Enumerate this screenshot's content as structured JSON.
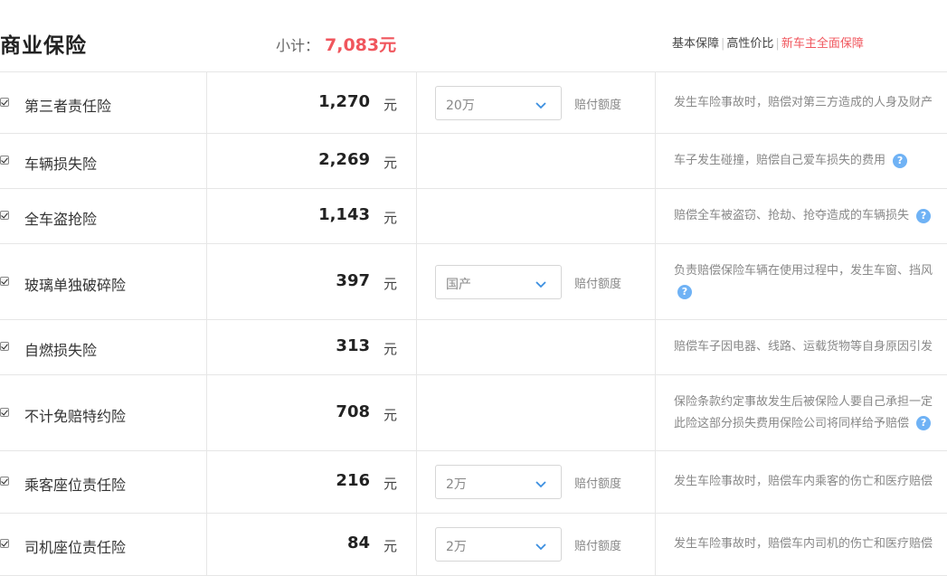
{
  "header": {
    "title": "商业保险",
    "subtotal_label": "小计：",
    "subtotal_value": "7,083元",
    "plans": [
      "基本保障",
      "高性价比",
      "新车主全面保障"
    ]
  },
  "currency_unit": "元",
  "coverage_label": "赔付额度",
  "colors": {
    "accent": "#f0565d",
    "help_icon": "#6fb2f5",
    "border": "#e6e6e6"
  },
  "rows": [
    {
      "name": "第三者责任险",
      "checked": true,
      "price": "1,270",
      "select": "20万",
      "desc_lines": [
        "发生车险事故时，赔偿对第三方造成的人身及财产"
      ]
    },
    {
      "name": "车辆损失险",
      "checked": true,
      "price": "2,269",
      "desc_lines": [
        "车子发生碰撞，赔偿自己爱车损失的费用"
      ]
    },
    {
      "name": "全车盗抢险",
      "checked": true,
      "price": "1,143",
      "desc_lines": [
        "赔偿全车被盗窃、抢劫、抢夺造成的车辆损失"
      ]
    },
    {
      "name": "玻璃单独破碎险",
      "checked": true,
      "price": "397",
      "select": "国产",
      "desc_lines": [
        "负责赔偿保险车辆在使用过程中，发生车窗、挡风",
        ""
      ]
    },
    {
      "name": "自燃损失险",
      "checked": true,
      "price": "313",
      "desc_lines": [
        "赔偿车子因电器、线路、运载货物等自身原因引发"
      ]
    },
    {
      "name": "不计免赔特约险",
      "checked": true,
      "price": "708",
      "desc_lines": [
        "保险条款约定事故发生后被保险人要自己承担一定",
        "此险这部分损失费用保险公司将同样给予赔偿"
      ]
    },
    {
      "name": "乘客座位责任险",
      "checked": true,
      "price": "216",
      "select": "2万",
      "desc_lines": [
        "发生车险事故时，赔偿车内乘客的伤亡和医疗赔偿"
      ]
    },
    {
      "name": "司机座位责任险",
      "checked": true,
      "price": "84",
      "select": "2万",
      "desc_lines": [
        "发生车险事故时，赔偿车内司机的伤亡和医疗赔偿"
      ]
    }
  ]
}
